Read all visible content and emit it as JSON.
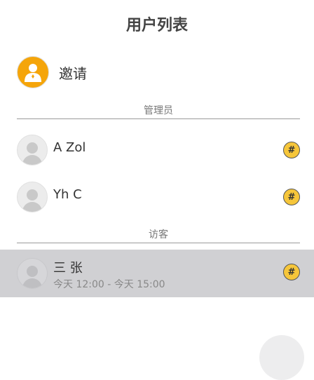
{
  "header": {
    "title": "用户列表"
  },
  "invite": {
    "label": "邀请"
  },
  "sections": {
    "admins": {
      "label": "管理员"
    },
    "guests": {
      "label": "访客"
    }
  },
  "users": [
    {
      "name": "A Zol",
      "badge": "#"
    },
    {
      "name": "Yh C",
      "badge": "#"
    },
    {
      "name": "三 张",
      "time": "今天 12:00 - 今天 15:00",
      "badge": "#",
      "selected": true
    }
  ],
  "colors": {
    "accent": "#f5a50a",
    "badge": "#f6c63a",
    "selected_row": "#d0d0d3"
  }
}
